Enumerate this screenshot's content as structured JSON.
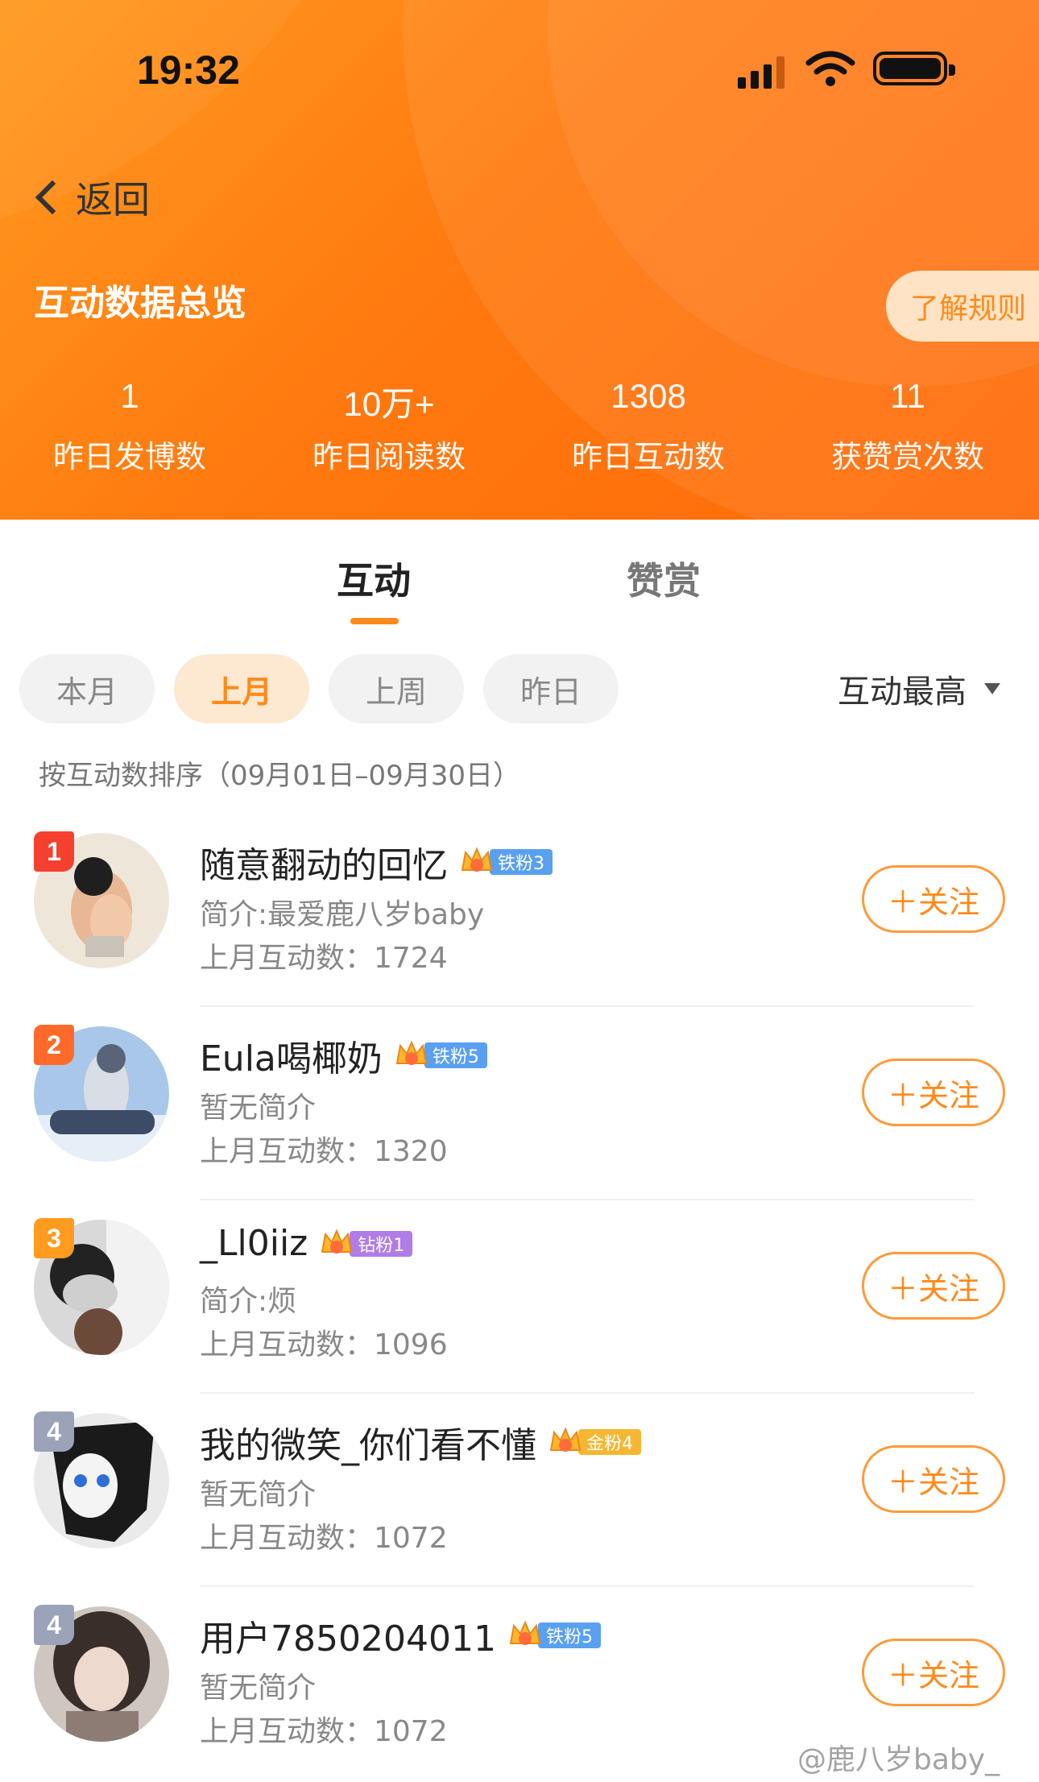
{
  "status_bar": {
    "time": "19:32"
  },
  "header": {
    "back_label": "返回",
    "title": "互动数据总览",
    "rules_button": "了解规则",
    "stats": [
      {
        "value": "1",
        "label": "昨日发博数"
      },
      {
        "value": "10万+",
        "label": "昨日阅读数"
      },
      {
        "value": "1308",
        "label": "昨日互动数"
      },
      {
        "value": "11",
        "label": "获赞赏次数"
      }
    ]
  },
  "tabs": {
    "active": "互动",
    "inactive": "赞赏"
  },
  "filters": {
    "pills": [
      "本月",
      "上月",
      "上周",
      "昨日"
    ],
    "active_index": 1,
    "sort_label": "互动最高"
  },
  "range_note": "按互动数排序（09月01日–09月30日）",
  "follow_label": "＋关注",
  "users": [
    {
      "rank": "1",
      "name": "随意翻动的回忆",
      "badge_level": "3",
      "badge_label": "铁粉3",
      "badge_color": "#5aa0f0",
      "intro": "简介:最爱鹿八岁baby",
      "count": "上月互动数：1724"
    },
    {
      "rank": "2",
      "name": "Eula喝椰奶",
      "badge_level": "3",
      "badge_label": "铁粉5",
      "badge_color": "#5aa0f0",
      "intro": "暂无简介",
      "count": "上月互动数：1320"
    },
    {
      "rank": "3",
      "name": "_Ll0iiz",
      "badge_level": "5",
      "badge_label": "钻粉1",
      "badge_color": "#b07ce8",
      "intro": "简介:烦",
      "count": "上月互动数：1096"
    },
    {
      "rank": "4",
      "name": "我的微笑_你们看不懂",
      "badge_level": "5",
      "badge_label": "金粉4",
      "badge_color": "#f5b731",
      "intro": "暂无简介",
      "count": "上月互动数：1072"
    },
    {
      "rank": "4",
      "name": "用户7850204011",
      "badge_level": "4",
      "badge_label": "铁粉5",
      "badge_color": "#5aa0f0",
      "intro": "暂无简介",
      "count": "上月互动数：1072"
    }
  ],
  "watermark": "@鹿八岁baby_"
}
